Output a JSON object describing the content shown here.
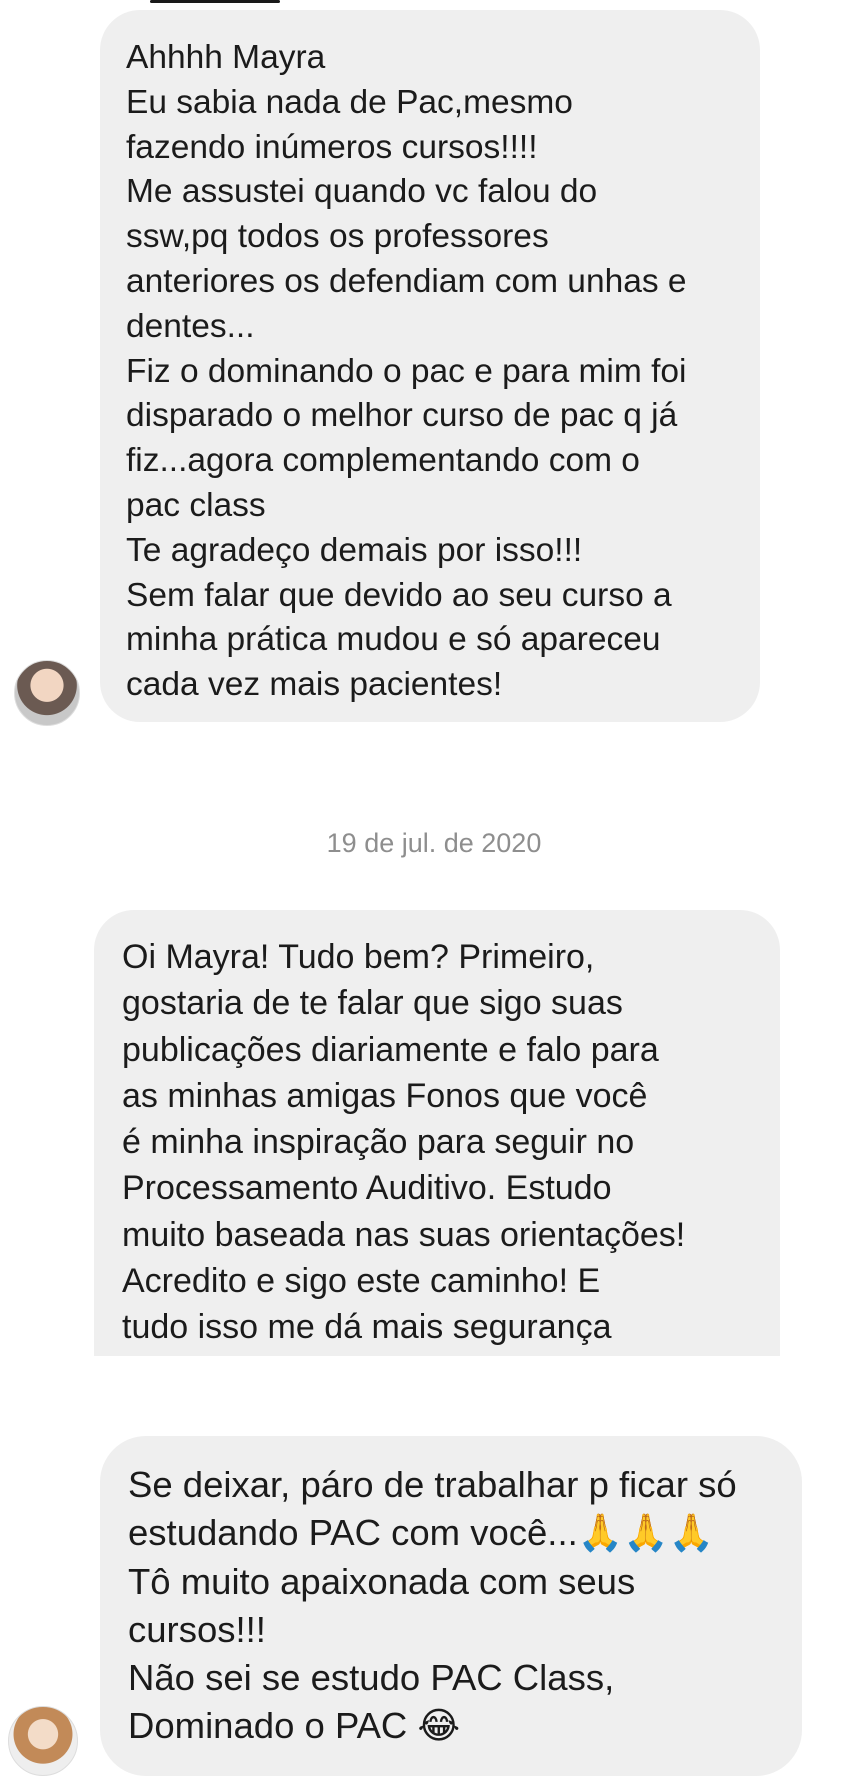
{
  "conversation": {
    "date_separator": "19 de jul. de 2020",
    "messages": [
      {
        "text": "Ahhhh Mayra\nEu sabia nada de Pac,mesmo\nfazendo inúmeros cursos!!!!\nMe assustei quando vc falou do\nssw,pq todos os professores\nanteriores os defendiam com unhas e\ndentes...\nFiz o dominando o pac e para mim foi\ndisparado o melhor curso de pac q já\nfiz...agora complementando com o\npac class\nTe agradeço demais por isso!!!\nSem falar que devido ao seu curso a\nminha prática mudou e só apareceu\ncada vez mais pacientes!"
      },
      {
        "text": "Oi Mayra! Tudo bem? Primeiro,\ngostaria de te falar que sigo suas\npublicações diariamente e falo para\nas minhas amigas Fonos que você\né minha inspiração para seguir no\nProcessamento Auditivo. Estudo\nmuito baseada nas suas orientações!\nAcredito e sigo este caminho! E\ntudo isso me dá mais segurança"
      },
      {
        "text": "Se deixar, páro de trabalhar p ficar só\nestudando PAC com você...🙏🙏🙏\nTô muito apaixonada com seus\ncursos!!!\nNão sei se estudo PAC Class,\nDominado o PAC 😂"
      }
    ]
  }
}
